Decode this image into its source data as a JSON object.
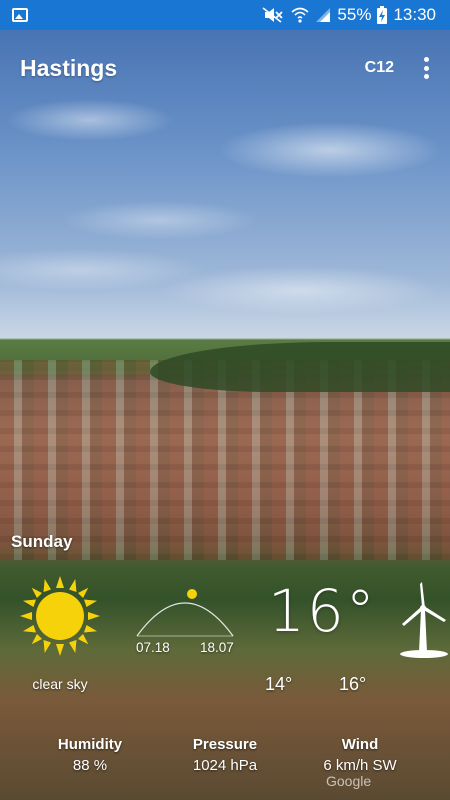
{
  "status_bar": {
    "battery_percent": "55%",
    "time": "13:30",
    "icons": [
      "gallery-icon",
      "mute-icon",
      "wifi-icon",
      "signal-icon",
      "battery-charging-icon"
    ]
  },
  "header": {
    "city": "Hastings",
    "units": "C12"
  },
  "weather": {
    "day": "Sunday",
    "icon": "sun-icon",
    "condition": "clear sky",
    "sunrise": "07.18",
    "sunset": "18.07",
    "temperature": "16°",
    "temp_min": "14°",
    "temp_max": "16°",
    "wind_icon": "wind-turbine-icon"
  },
  "stats": {
    "humidity_label": "Humidity",
    "humidity_value": "88 %",
    "pressure_label": "Pressure",
    "pressure_value": "1024 hPa",
    "wind_label": "Wind",
    "wind_value": "6 km/h SW"
  },
  "attribution": "Google",
  "colors": {
    "status_bar": "#1976d2",
    "sun": "#f5d20a"
  }
}
